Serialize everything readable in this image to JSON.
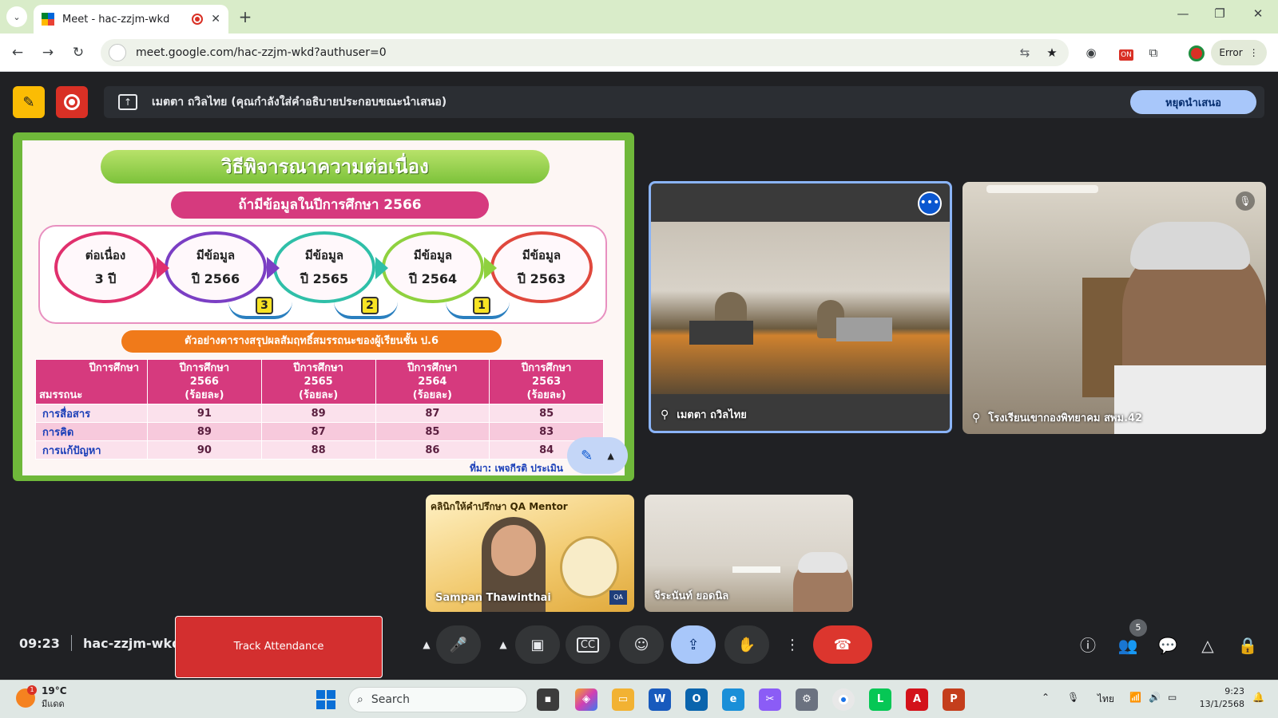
{
  "browser": {
    "tab_title": "Meet - hac-zzjm-wkd",
    "close_glyph": "✕",
    "new_tab_glyph": "+",
    "tabs_menu_glyph": "⌄",
    "url": "meet.google.com/hac-zzjm-wkd?authuser=0",
    "profile_status": "Error",
    "extension_badge": "ON",
    "window_controls": [
      "—",
      "❐",
      "✕"
    ],
    "nav": [
      "←",
      "→",
      "↻"
    ]
  },
  "presenting_bar": {
    "message": "เมตตา ถวิลไทย (คุณกำลังใส่คำอธิบายประกอบขณะนำเสนอ)",
    "stop_label": "หยุดนำเสนอ"
  },
  "slide": {
    "title": "วิธีพิจารณาความต่อเนื่อง",
    "subtitle": "ถ้ามีข้อมูลในปีการศึกษา 2566",
    "flow": [
      {
        "line1": "ต่อเนื่อง",
        "line2": "3 ปี",
        "color": "#e0306d"
      },
      {
        "line1": "มีข้อมูล",
        "line2": "ปี 2566",
        "color": "#7b3fc4"
      },
      {
        "line1": "มีข้อมูล",
        "line2": "ปี 2565",
        "color": "#2fbfa8"
      },
      {
        "line1": "มีข้อมูล",
        "line2": "ปี 2564",
        "color": "#8fd13f"
      },
      {
        "line1": "มีข้อมูล",
        "line2": "ปี 2563",
        "color": "#e0483d"
      }
    ],
    "step_badges": [
      "3",
      "2",
      "1"
    ],
    "example_caption": "ตัวอย่างตารางสรุปผลสัมฤทธิ์สมรรถนะของผู้เรียนชั้น ป.6",
    "table": {
      "corner_top": "ปีการศึกษา",
      "corner_bottom": "สมรรถนะ",
      "headers": [
        {
          "l1": "ปีการศึกษา",
          "l2": "2566",
          "l3": "(ร้อยละ)"
        },
        {
          "l1": "ปีการศึกษา",
          "l2": "2565",
          "l3": "(ร้อยละ)"
        },
        {
          "l1": "ปีการศึกษา",
          "l2": "2564",
          "l3": "(ร้อยละ)"
        },
        {
          "l1": "ปีการศึกษา",
          "l2": "2563",
          "l3": "(ร้อยละ)"
        }
      ],
      "rows": [
        {
          "label": "การสื่อสาร",
          "values": [
            "91",
            "89",
            "87",
            "85"
          ]
        },
        {
          "label": "การคิด",
          "values": [
            "89",
            "87",
            "85",
            "83"
          ]
        },
        {
          "label": "การแก้ปัญหา",
          "values": [
            "90",
            "88",
            "86",
            "84"
          ]
        }
      ]
    },
    "source": "ที่มา: เพจกีรติ ประเมิน"
  },
  "participants": {
    "main1_name": "เมตตา ถวิลไทย",
    "main2_name": "โรงเรียนเขากองพิทยาคม สพม.42",
    "thumb1_name": "Sampan Thawinthai",
    "thumb1_banner": "คลินิกให้คำปรึกษา QA Mentor",
    "thumb2_name": "จีระนันท์ ยอดนิล"
  },
  "meeting": {
    "time": "09:23",
    "code": "hac-zzjm-wkd",
    "track_attendance_label": "Track Attendance",
    "people_count": "5"
  },
  "taskbar": {
    "temp": "19°C",
    "weather_desc": "มีแดด",
    "weather_badge": "1",
    "search_label": "Search",
    "lang": "ไทย",
    "clock_time": "9:23",
    "clock_date": "13/1/2568"
  }
}
